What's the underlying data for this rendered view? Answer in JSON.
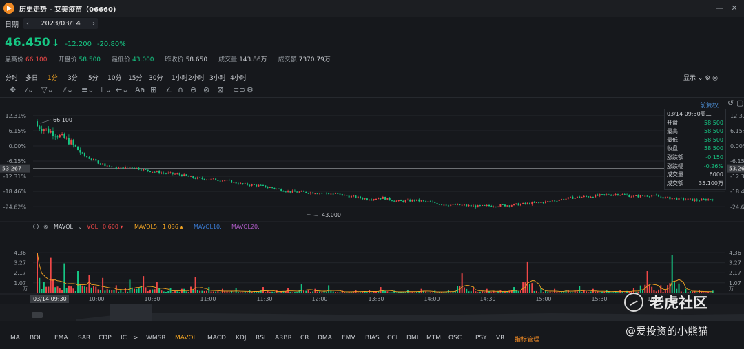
{
  "window": {
    "title": "历史走势 - 艾美疫苗（06660)"
  },
  "date_bar": {
    "label": "日期",
    "prev": "‹",
    "next": "›",
    "value": "2023/03/14"
  },
  "quote": {
    "price": "46.450",
    "arrow": "↓",
    "change": "-12.200",
    "change_pct": "-20.80%",
    "stats": [
      {
        "label": "最高价",
        "value": "66.100",
        "tone": "up"
      },
      {
        "label": "开盘价",
        "value": "58.500",
        "tone": "dn"
      },
      {
        "label": "最低价",
        "value": "43.000",
        "tone": "dn"
      },
      {
        "label": "昨收价",
        "value": "58.650",
        "tone": "wt"
      },
      {
        "label": "成交量",
        "value": "143.86万",
        "tone": "wt"
      },
      {
        "label": "成交额",
        "value": "7370.79万",
        "tone": "wt"
      }
    ]
  },
  "periods": [
    "分时",
    "多日",
    "1分",
    "3分",
    "5分",
    "10分",
    "15分",
    "30分",
    "1小时",
    "2小时",
    "3小时",
    "4小时"
  ],
  "active_period": "1分",
  "display_label": "显示",
  "fuquan_label": "前复权",
  "price_axis": {
    "left_ticks": [
      "12.31%",
      "6.15%",
      "0.00%",
      "-6.15%",
      "-12.31%",
      "-18.46%",
      "-24.62%"
    ],
    "right_ticks": [
      "12.31%",
      "6.15%",
      "0.00%",
      "-6.15%",
      "-12.31%",
      "-18.46%",
      "-24.62%"
    ],
    "ref_price": "53.267",
    "high_label": "66.100",
    "low_label": "43.000"
  },
  "infobox": {
    "time": "03/14 09:30周二",
    "rows": [
      {
        "label": "开盘",
        "value": "58.500",
        "green": true
      },
      {
        "label": "最高",
        "value": "58.500",
        "green": true
      },
      {
        "label": "最低",
        "value": "58.500",
        "green": true
      },
      {
        "label": "收盘",
        "value": "58.500",
        "green": true
      },
      {
        "label": "涨跌额",
        "value": "-0.150",
        "green": true
      },
      {
        "label": "涨跌幅",
        "value": "-0.26%",
        "green": true
      },
      {
        "label": "成交量",
        "value": "6000",
        "green": false
      },
      {
        "label": "成交额",
        "value": "35.100万",
        "green": false
      }
    ]
  },
  "volume_panel": {
    "name": "MAVOL",
    "vol_label": "VOL:",
    "vol_value": "0.600",
    "mavol5_label": "MAVOL5:",
    "mavol5_value": "1.036",
    "mavol10_label": "MAVOL10:",
    "mavol20_label": "MAVOL20:",
    "ticks": [
      "4.36",
      "3.27",
      "2.17",
      "1.07",
      "万"
    ]
  },
  "time_axis": {
    "first": "03/14 09:30",
    "labels": [
      "10:00",
      "10:30",
      "11:00",
      "11:30",
      "12:00",
      "13:30",
      "14:00",
      "14:30",
      "15:00",
      "15:30",
      "16:00"
    ]
  },
  "indicators": [
    "MA",
    "BOLL",
    "EMA",
    "SAR",
    "CDP",
    "IC",
    ">",
    "WMSR",
    "MAVOL",
    "MACD",
    "KDJ",
    "RSI",
    "ARBR",
    "CR",
    "DMA",
    "EMV",
    "BIAS",
    "CCI",
    "DMI",
    "MTM",
    "OSC",
    "PSY",
    "VR",
    "指标管理"
  ],
  "active_indicator": "MAVOL",
  "watermark": {
    "brand": "老虎社区",
    "author": "@爱投资的小熊猫"
  },
  "colors": {
    "up": "#f04848",
    "down": "#16c784",
    "accent": "#f5a623",
    "mavol5": "#f5a623",
    "mavol10": "#3a7bd5",
    "mavol20": "#b05cc8",
    "background": "#16181c"
  },
  "chart_data": {
    "type": "candlestick",
    "x_labels": [
      "03/14 09:30",
      "10:00",
      "10:30",
      "11:00",
      "11:30",
      "12:00",
      "13:30",
      "14:00",
      "14:30",
      "15:00",
      "15:30",
      "16:00"
    ],
    "price_pct": {
      "ylim": [
        -26.5,
        14.5
      ],
      "series": [
        {
          "name": "close",
          "values": [
            8.0,
            5.5,
            2.0,
            -4.0,
            -7.0,
            -9.0,
            -8.5,
            -10.0,
            -11.0,
            -11.5,
            -13.0,
            -13.5,
            -14.0,
            -15.5,
            -16.0,
            -17.0,
            -18.5,
            -18.8,
            -19.0,
            -19.5,
            -20.5,
            -21.5,
            -21.0,
            -22.5,
            -22.0,
            -22.8,
            -23.8,
            -24.0,
            -24.5,
            -24.2,
            -24.0,
            -23.5,
            -23.0,
            -22.0,
            -21.0,
            -20.5,
            -20.0,
            -19.5,
            -20.5,
            -20.0,
            -21.0,
            -21.5,
            -22.0,
            -21.5
          ]
        }
      ]
    },
    "volume": {
      "ylim": [
        0,
        4.6
      ],
      "unit": "万",
      "values": [
        4.36,
        3.8,
        3.2,
        2.4,
        1.9,
        1.6,
        0.8,
        1.4,
        1.8,
        1.2,
        0.5,
        0.4,
        1.7,
        0.6,
        0.4,
        0.5,
        0.3,
        0.6,
        0.3,
        0.5,
        0.9,
        0.4,
        0.8,
        0.2,
        0.3,
        0.3,
        0.6,
        0.2,
        0.3,
        0.4,
        0.2,
        0.3,
        2.1,
        0.5,
        0.4,
        0.3,
        0.6,
        3.4,
        0.5,
        0.4,
        0.3,
        0.7,
        0.4,
        0.3,
        0.3,
        0.5,
        2.4,
        0.8,
        4.1,
        0.4,
        0.3,
        0.2
      ]
    }
  }
}
